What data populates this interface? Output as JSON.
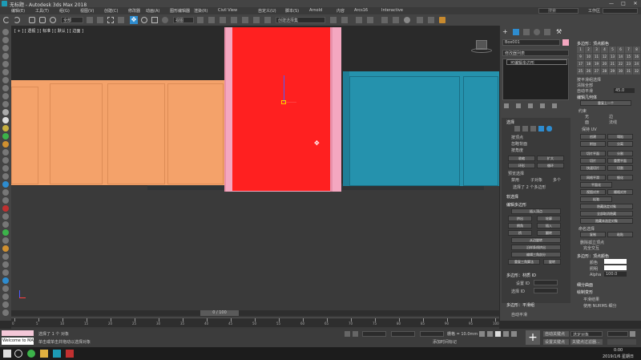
{
  "app": {
    "title": "无标题 - Autodesk 3ds Max 2018",
    "min_icon": "—",
    "max_icon": "□",
    "close_icon": "✕",
    "search": "搜索",
    "workspace": "工作区"
  },
  "menu": [
    "编辑(E)",
    "工具(T)",
    "组(G)",
    "视图(V)",
    "创建(C)",
    "修改器",
    "动画(A)",
    "图形编辑器",
    "渲染(R)",
    "Civil View",
    "自定义(U)",
    "脚本(S)",
    "Arnold",
    "内容",
    "Arcs16",
    "Interactive"
  ],
  "toolbar": {
    "dropdown1": "全部",
    "dropdown2": "视图",
    "dropdown3": "创建选择集"
  },
  "viewport": {
    "label": "[ + ] [ 透视 ] [ 标准 ] [ 默认 ] [ 边面 ]",
    "cursor_icon": "✥"
  },
  "command_panel": {
    "object_name": "Box001",
    "modifier_list": "修改器列表",
    "stack_item": "可编辑多边形",
    "selection": {
      "header": "选择",
      "items": [
        "按顶点",
        "忽略背面",
        "按角度"
      ],
      "shrink": "收缩",
      "grow": "扩大",
      "ring": "环形",
      "loop": "循环",
      "preview": "预览选择",
      "off": "禁用",
      "subobj": "子对象",
      "multi": "多个",
      "status": "选择了 2 个多边形"
    },
    "soft": {
      "header": "软选择"
    },
    "edit_poly": {
      "header": "编辑多边形",
      "insert_vertex": "插入顶点",
      "extrude": "挤出",
      "outline": "轮廓",
      "bevel": "倒角",
      "inset": "插入",
      "bridge": "桥",
      "flip": "翻转",
      "hinge": "从边旋转",
      "along_spline": "沿样条线挤出",
      "edit_tri": "编辑三角剖分",
      "retriangulate": "重复三角算法",
      "turn": "旋转"
    },
    "poly_material": {
      "header": "多边形：材质 ID",
      "set_id": "设置 ID",
      "select_id": "选择 ID",
      "smooth_header": "多边形：平滑组",
      "auto": "自动平滑"
    }
  },
  "right_panel": {
    "vertex_colors": "多边形：顶点颜色",
    "edit_geometry": "编辑几何体",
    "repeat_last": "重复上一个",
    "constraints": "约束",
    "none": "无",
    "edge": "边",
    "face": "面",
    "normal": "法线",
    "preserve_uv": "保持 UV",
    "create": "创建",
    "collapse": "塌陷",
    "attach": "附加",
    "detach": "分离",
    "slice_plane": "切片平面",
    "split": "分割",
    "slice": "切片",
    "reset_plane": "重置平面",
    "quickslice": "快速切片",
    "cut": "切割",
    "meshsmooth": "网格平滑",
    "tessellate": "细化",
    "make_planar": "平面化",
    "view_align": "视图对齐",
    "grid_align": "栅格对齐",
    "relax": "松弛",
    "hide_sel": "隐藏选定对象",
    "unhide_all": "全部取消隐藏",
    "hide_unsel": "隐藏未选定对象",
    "named_sel": "命名选择",
    "copy": "复制",
    "paste": "粘贴",
    "delete_iso": "删除孤立顶点",
    "full_interactivity": "完全交互",
    "vc_header": "多边形：顶点颜色",
    "color": "颜色",
    "illum": "照明",
    "alpha": "Alpha",
    "alpha_val": "100.0",
    "subdiv": "细分曲面",
    "paint": "绘制变形",
    "smooth_result": "平滑结果",
    "use_nurms": "使用 NURMS 细分",
    "grid": [
      "1",
      "2",
      "3",
      "4",
      "5",
      "6",
      "7",
      "8",
      "9",
      "10",
      "11",
      "12",
      "13",
      "14",
      "15",
      "16",
      "17",
      "18",
      "19",
      "20",
      "21",
      "22",
      "23",
      "24",
      "25",
      "26",
      "27",
      "28",
      "29",
      "30",
      "31",
      "32"
    ],
    "clear_all": "清除全部",
    "select_by_sg": "按平滑组选择",
    "auto_smooth": "自动平滑",
    "angle": "45.0"
  },
  "timeline": {
    "frame": "0 / 100",
    "ticks": [
      "0",
      "5",
      "10",
      "15",
      "20",
      "25",
      "30",
      "35",
      "40",
      "45",
      "50",
      "55",
      "60",
      "65",
      "70",
      "75",
      "80",
      "85",
      "90",
      "95",
      "100"
    ]
  },
  "status": {
    "selected": "选择了 1 个 对象",
    "hint": "单击或单击并拖动以选择对象",
    "script": "Welcome to MAX",
    "grid": "栅格 = 10.0mm",
    "add_time": "添加时间标记",
    "auto_key": "自动关键点",
    "set_key": "设置关键点",
    "selected_obj": "选定对象",
    "key_filters": "关键点过滤器..."
  },
  "taskbar": {
    "time": "0:00",
    "date": "2019/1/6 星期日"
  },
  "colors": {
    "accent": "#2e8ccf",
    "red_door": "#ff2020",
    "pink": "#f4a7c0",
    "orange": "#f4a26a",
    "teal": "#2592ad"
  }
}
